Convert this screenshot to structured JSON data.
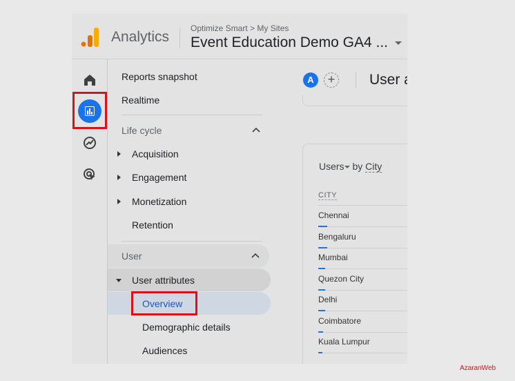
{
  "header": {
    "app_name": "Analytics",
    "breadcrumb": "Optimize Smart > My Sites",
    "property": "Event Education Demo GA4 ...",
    "logo_colors": [
      "#f9ab00",
      "#e37400"
    ]
  },
  "rail": {
    "items": [
      {
        "icon": "home-icon"
      },
      {
        "icon": "reports-icon",
        "active": true
      },
      {
        "icon": "explore-icon"
      },
      {
        "icon": "advertising-icon"
      }
    ]
  },
  "nav": {
    "reports_snapshot": "Reports snapshot",
    "realtime": "Realtime",
    "lifecycle": {
      "label": "Life cycle",
      "items": [
        "Acquisition",
        "Engagement",
        "Monetization",
        "Retention"
      ]
    },
    "user": {
      "label": "User",
      "group": "User attributes",
      "items": [
        "Overview",
        "Demographic details",
        "Audiences"
      ],
      "selected": "Overview"
    }
  },
  "toolbar": {
    "avatar": "A",
    "title": "User a"
  },
  "card": {
    "metric": "Users",
    "by": "by",
    "dimension": "City",
    "column": "CITY",
    "rows": [
      {
        "city": "Chennai",
        "share": 0.09
      },
      {
        "city": "Bengaluru",
        "share": 0.09
      },
      {
        "city": "Mumbai",
        "share": 0.07
      },
      {
        "city": "Quezon City",
        "share": 0.07
      },
      {
        "city": "Delhi",
        "share": 0.07
      },
      {
        "city": "Coimbatore",
        "share": 0.05
      },
      {
        "city": "Kuala Lumpur",
        "share": 0.04
      }
    ]
  },
  "watermark": "AzaranWeb",
  "colors": {
    "accent": "#1a73e8",
    "highlight_box": "#d6121b"
  }
}
